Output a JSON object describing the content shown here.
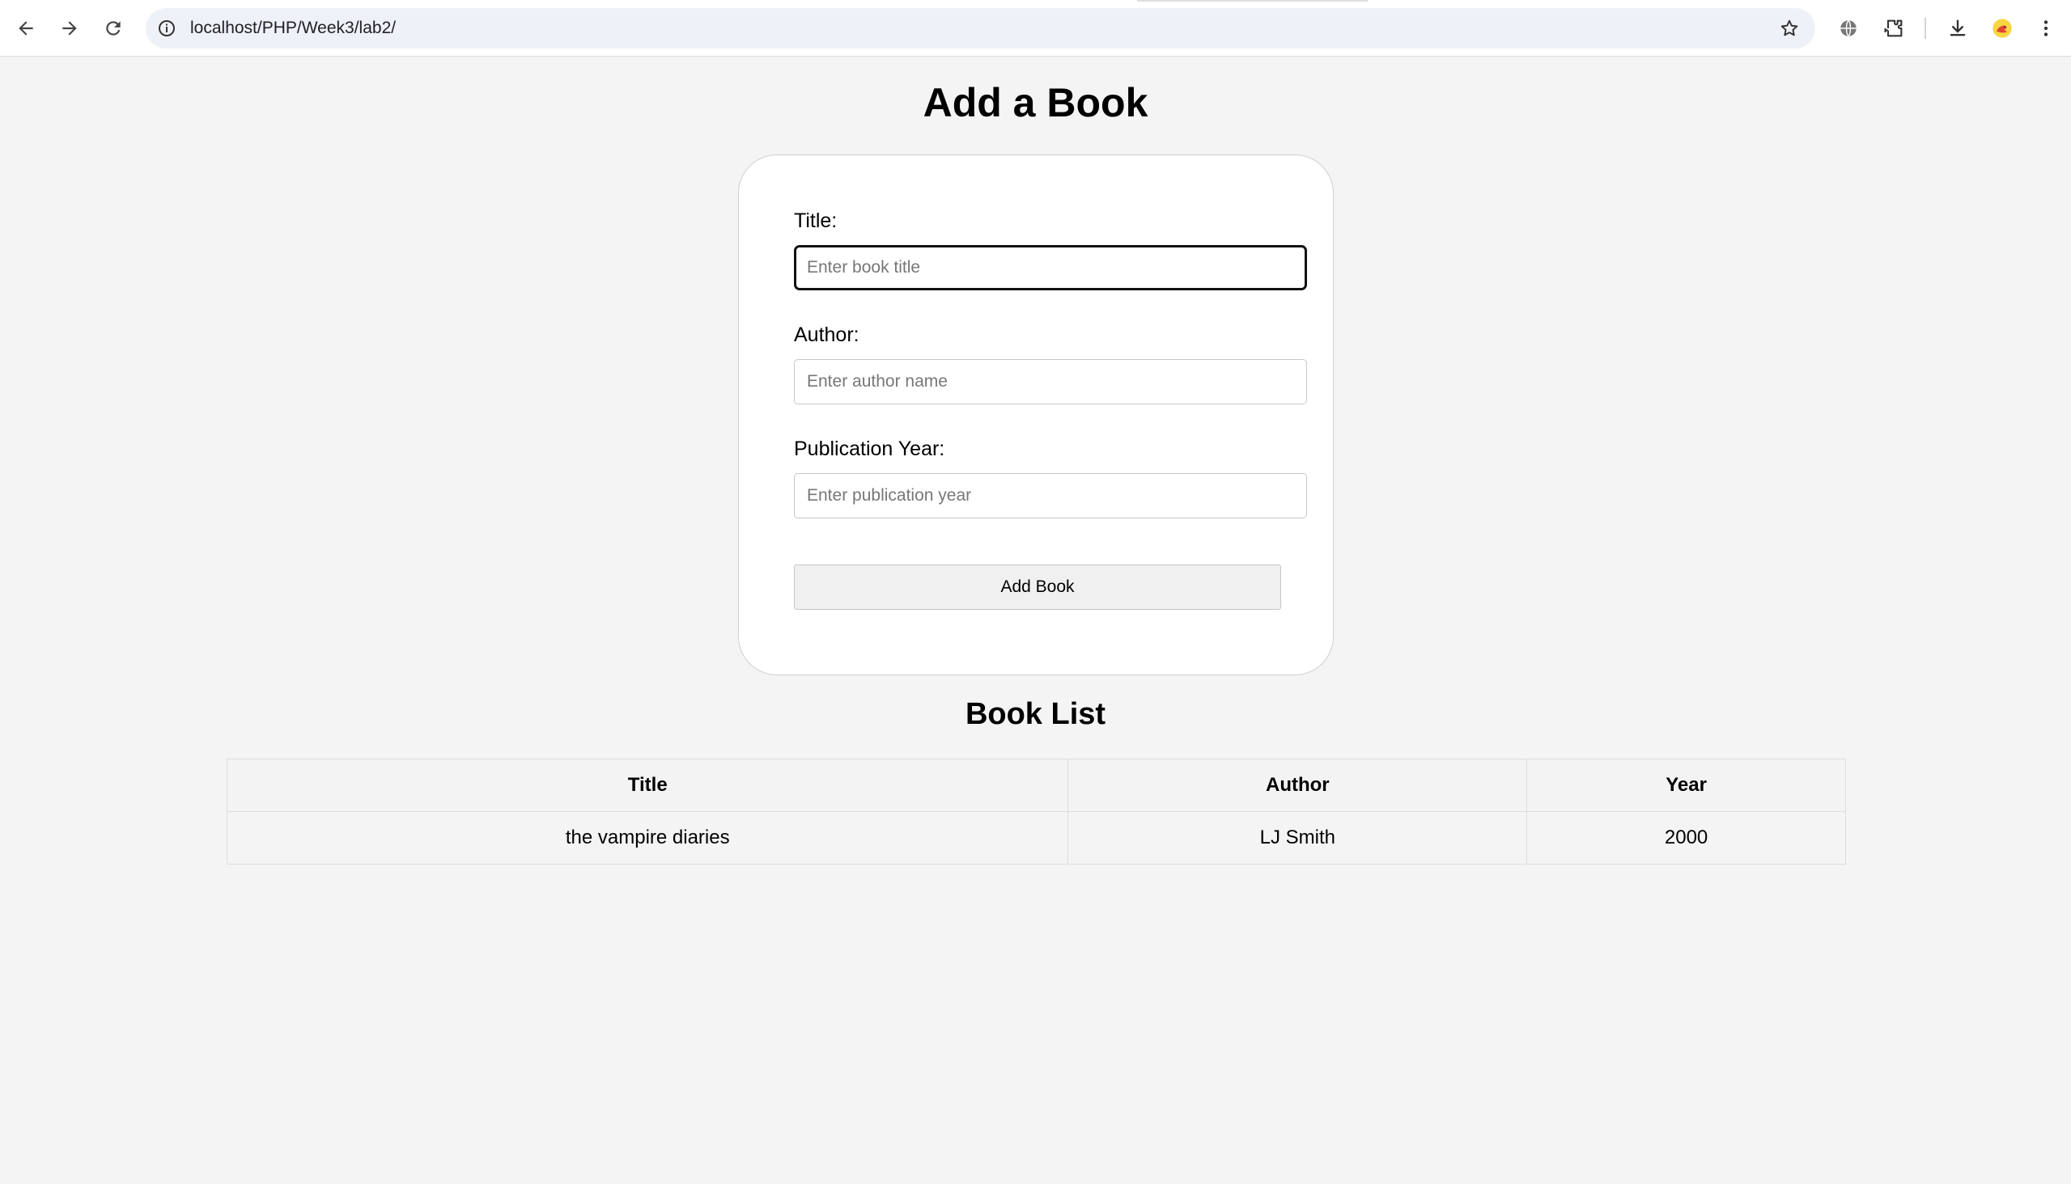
{
  "browser": {
    "url": "localhost/PHP/Week3/lab2/",
    "icons": [
      "back-arrow-icon",
      "forward-arrow-icon",
      "reload-icon",
      "site-info-icon",
      "bookmark-star-icon",
      "translate-globe-icon",
      "extensions-puzzle-icon",
      "download-icon",
      "profile-avatar-icon",
      "more-menu-icon"
    ]
  },
  "page": {
    "title": "Add a Book"
  },
  "form": {
    "title_label": "Title:",
    "title_placeholder": "Enter book title",
    "title_value": "",
    "author_label": "Author:",
    "author_placeholder": "Enter author name",
    "author_value": "",
    "year_label": "Publication Year:",
    "year_placeholder": "Enter publication year",
    "year_value": "",
    "submit_label": "Add Book"
  },
  "book_list": {
    "heading": "Book List",
    "columns": [
      "Title",
      "Author",
      "Year"
    ],
    "rows": [
      [
        "the vampire diaries",
        "LJ Smith",
        "2000"
      ]
    ]
  }
}
